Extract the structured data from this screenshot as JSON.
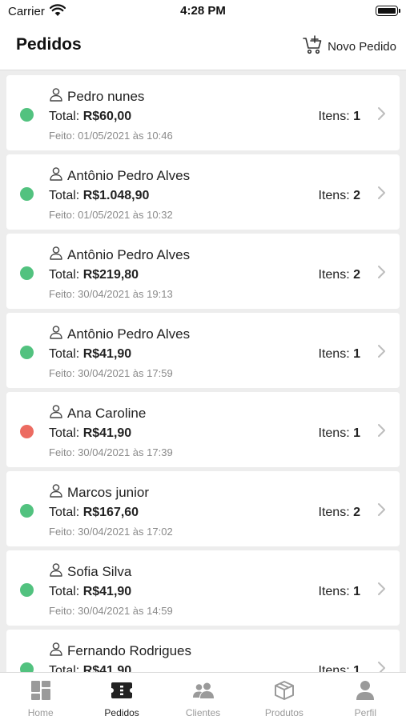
{
  "status_bar": {
    "carrier": "Carrier",
    "time": "4:28 PM"
  },
  "header": {
    "title": "Pedidos",
    "new_order_label": "Novo Pedido"
  },
  "labels": {
    "total": "Total: ",
    "items": "Itens: ",
    "date_prefix": "Feito: "
  },
  "status_colors": {
    "concluido": "#52c27f",
    "cancelado": "#ec6b61"
  },
  "orders": [
    {
      "customer": "Pedro nunes",
      "total": "R$60,00",
      "items": "1",
      "date": "01/05/2021 às 10:46",
      "status": "concluido"
    },
    {
      "customer": "Antônio Pedro Alves",
      "total": "R$1.048,90",
      "items": "2",
      "date": "01/05/2021 às 10:32",
      "status": "concluido"
    },
    {
      "customer": "Antônio Pedro Alves",
      "total": "R$219,80",
      "items": "2",
      "date": "30/04/2021 às 19:13",
      "status": "concluido"
    },
    {
      "customer": "Antônio Pedro Alves",
      "total": "R$41,90",
      "items": "1",
      "date": "30/04/2021 às 17:59",
      "status": "concluido"
    },
    {
      "customer": "Ana Caroline",
      "total": "R$41,90",
      "items": "1",
      "date": "30/04/2021 às 17:39",
      "status": "cancelado"
    },
    {
      "customer": "Marcos junior",
      "total": "R$167,60",
      "items": "2",
      "date": "30/04/2021 às 17:02",
      "status": "concluido"
    },
    {
      "customer": "Sofia Silva",
      "total": "R$41,90",
      "items": "1",
      "date": "30/04/2021 às 14:59",
      "status": "concluido"
    },
    {
      "customer": "Fernando Rodrigues",
      "total": "R$41,90",
      "items": "1",
      "date": "",
      "status": "concluido"
    }
  ],
  "tabs": [
    {
      "label": "Home",
      "icon": "dashboard-icon",
      "active": false
    },
    {
      "label": "Pedidos",
      "icon": "ticket-icon",
      "active": true
    },
    {
      "label": "Clientes",
      "icon": "users-icon",
      "active": false
    },
    {
      "label": "Produtos",
      "icon": "box-icon",
      "active": false
    },
    {
      "label": "Perfil",
      "icon": "person-icon",
      "active": false
    }
  ]
}
